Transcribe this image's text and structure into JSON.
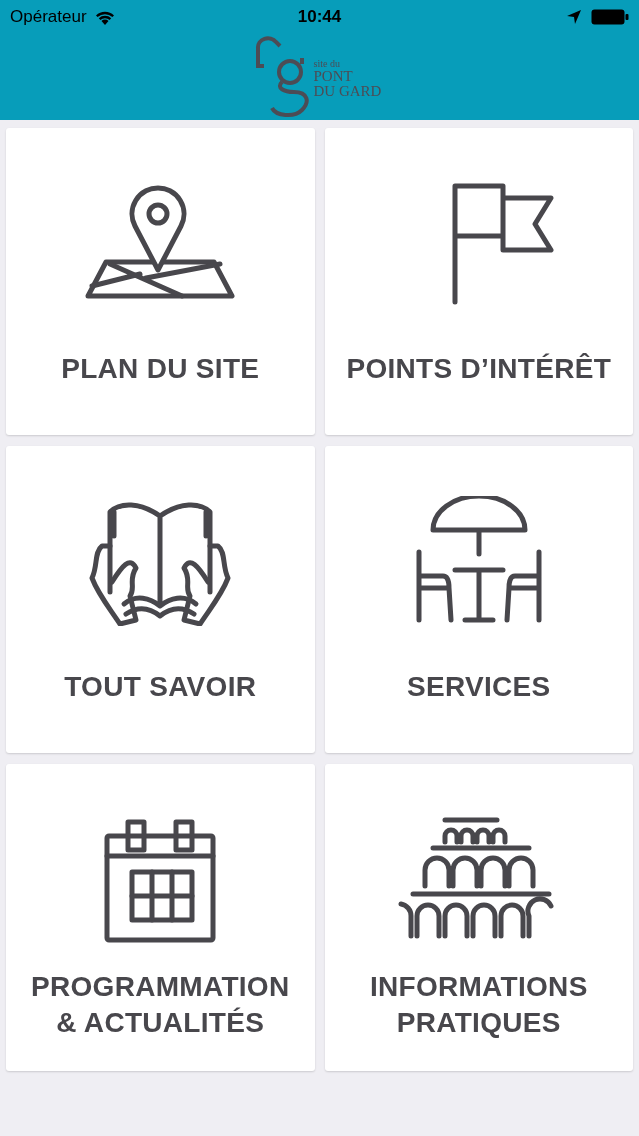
{
  "status_bar": {
    "carrier": "Opérateur",
    "time": "10:44"
  },
  "header": {
    "logo": {
      "small": "site du",
      "line_1": "PONT",
      "line_2": "DU GARD"
    }
  },
  "tiles": [
    {
      "label": "PLAN DU SITE"
    },
    {
      "label": "POINTS D’INTÉRÊT"
    },
    {
      "label": "TOUT SAVOIR"
    },
    {
      "label": "SERVICES"
    },
    {
      "label": "PROGRAMMATION & ACTUALITÉS"
    },
    {
      "label": "INFORMATIONS PRATIQUES"
    }
  ]
}
